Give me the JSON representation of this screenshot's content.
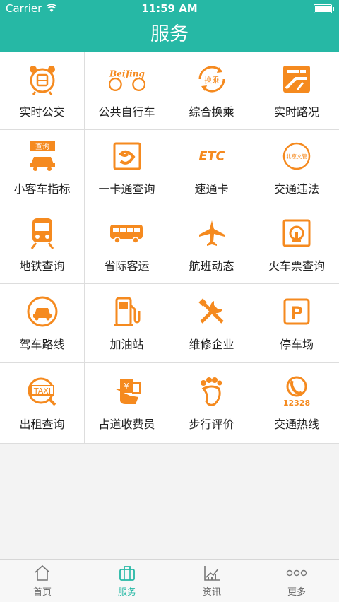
{
  "status_bar": {
    "carrier": "Carrier",
    "time": "11:59 AM"
  },
  "header": {
    "title": "服务"
  },
  "services": [
    {
      "label": "实时公交",
      "icon": "bus-alarm-icon"
    },
    {
      "label": "公共自行车",
      "icon": "beijing-bike-icon",
      "icon_text": "BeiJing"
    },
    {
      "label": "综合换乘",
      "icon": "transfer-icon",
      "icon_text": "换乘"
    },
    {
      "label": "实时路况",
      "icon": "traffic-map-icon"
    },
    {
      "label": "小客车指标",
      "icon": "car-query-icon",
      "icon_text": "查询"
    },
    {
      "label": "一卡通查询",
      "icon": "transit-card-icon"
    },
    {
      "label": "速通卡",
      "icon": "etc-icon",
      "icon_text": "ETC"
    },
    {
      "label": "交通违法",
      "icon": "traffic-violation-icon",
      "icon_text": "北京文管"
    },
    {
      "label": "地铁查询",
      "icon": "subway-train-icon"
    },
    {
      "label": "省际客运",
      "icon": "coach-bus-icon"
    },
    {
      "label": "航班动态",
      "icon": "airplane-icon"
    },
    {
      "label": "火车票查询",
      "icon": "rail-logo-icon"
    },
    {
      "label": "驾车路线",
      "icon": "car-route-icon"
    },
    {
      "label": "加油站",
      "icon": "gas-pump-icon"
    },
    {
      "label": "维修企业",
      "icon": "wrench-screwdriver-icon"
    },
    {
      "label": "停车场",
      "icon": "parking-icon",
      "icon_text": "P"
    },
    {
      "label": "出租查询",
      "icon": "taxi-search-icon",
      "icon_text": "TAXI"
    },
    {
      "label": "占道收费员",
      "icon": "toll-collector-icon",
      "icon_text": "¥"
    },
    {
      "label": "步行评价",
      "icon": "footprint-icon"
    },
    {
      "label": "交通热线",
      "icon": "hotline-phone-icon",
      "icon_text": "12328"
    }
  ],
  "tabbar": {
    "tabs": [
      {
        "label": "首页",
        "icon": "home-icon"
      },
      {
        "label": "服务",
        "icon": "briefcase-icon",
        "active": true
      },
      {
        "label": "资讯",
        "icon": "chart-icon"
      },
      {
        "label": "更多",
        "icon": "more-dots-icon"
      }
    ]
  },
  "colors": {
    "accent": "#26b8a5",
    "icon_orange": "#f58a1f"
  }
}
